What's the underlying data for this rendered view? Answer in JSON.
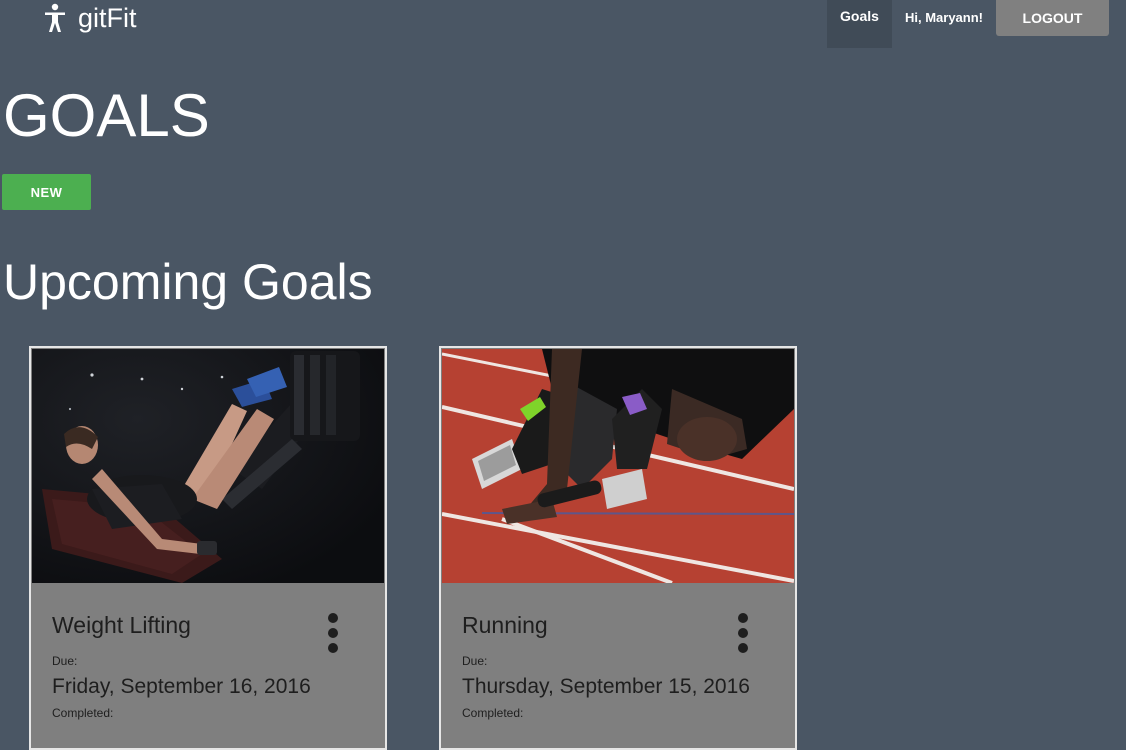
{
  "navbar": {
    "brand_name": "gitFit",
    "brand_icon": "person-accessibility-icon",
    "goals_label": "Goals",
    "greeting": "Hi, Maryann!",
    "logout_label": "LOGOUT"
  },
  "page": {
    "title": "GOALS",
    "new_button_label": "NEW",
    "section_title": "Upcoming Goals"
  },
  "goals": [
    {
      "name": "Weight Lifting",
      "image": "leg-press-workout-photo",
      "due_label": "Due:",
      "due_date": "Friday, September 16, 2016",
      "completed_label": "Completed:",
      "menu_icon": "more-vertical-icon"
    },
    {
      "name": "Running",
      "image": "sprinter-starting-blocks-photo",
      "due_label": "Due:",
      "due_date": "Thursday, September 15, 2016",
      "completed_label": "Completed:",
      "menu_icon": "more-vertical-icon"
    }
  ],
  "colors": {
    "background": "#4a5664",
    "nav_active": "#404b57",
    "logout_button": "#808080",
    "new_button": "#4caf50",
    "card_body": "#7f7f7f",
    "card_border": "#e6e6e6"
  }
}
